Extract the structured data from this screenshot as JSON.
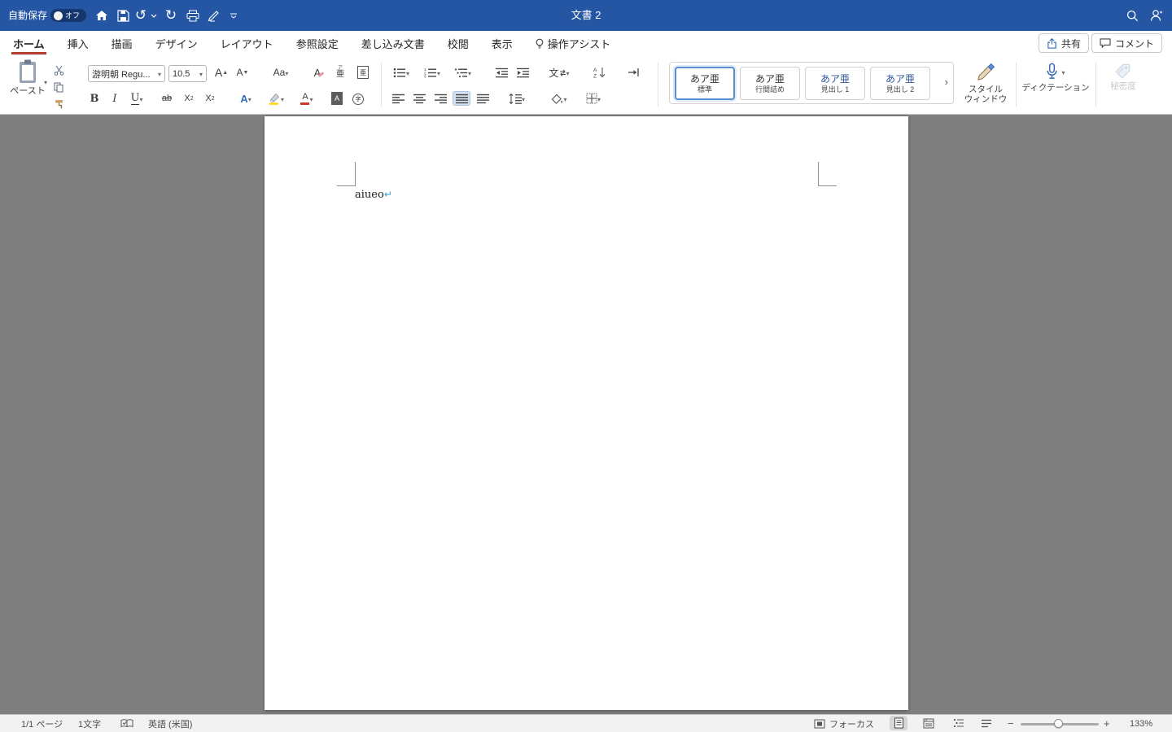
{
  "titlebar": {
    "autosave_label": "自動保存",
    "autosave_state": "オフ",
    "title": "文書 2"
  },
  "tabs": {
    "items": [
      {
        "label": "ホーム"
      },
      {
        "label": "挿入"
      },
      {
        "label": "描画"
      },
      {
        "label": "デザイン"
      },
      {
        "label": "レイアウト"
      },
      {
        "label": "参照設定"
      },
      {
        "label": "差し込み文書"
      },
      {
        "label": "校閲"
      },
      {
        "label": "表示"
      }
    ],
    "assist_label": "操作アシスト",
    "share_label": "共有",
    "comments_label": "コメント"
  },
  "ribbon": {
    "paste_label": "ペースト",
    "font_name": "游明朝 Regu...",
    "font_size": "10.5",
    "format": {
      "grow": "A",
      "shrink": "A",
      "case_label": "Aa",
      "clear": "A",
      "ruby_top": "ア",
      "ruby_base": "亜",
      "enclose_box": "亜",
      "bold": "B",
      "italic": "I",
      "underline": "U",
      "strikethrough": "ab",
      "sub_base": "X",
      "sub_script": "2",
      "sup_base": "X",
      "sup_script": "2",
      "effects": "A",
      "font_color": "A",
      "char_shade": "A",
      "enclose_circle": "字",
      "asian_layout": "文"
    },
    "styles": {
      "cards": [
        {
          "preview": "あア亜",
          "label": "標準"
        },
        {
          "preview": "あア亜",
          "label": "行間詰め"
        },
        {
          "preview": "あア亜",
          "label": "見出し 1"
        },
        {
          "preview": "あア亜",
          "label": "見出し 2"
        }
      ],
      "window_line1": "スタイル",
      "window_line2": "ウィンドウ"
    },
    "dictation_label": "ディクテーション",
    "sensitivity_label": "秘密度"
  },
  "document": {
    "text": "aiueo",
    "return_mark": "↵"
  },
  "statusbar": {
    "page_label": "1/1 ページ",
    "char_count": "1文字",
    "language": "英語 (米国)",
    "focus_label": "フォーカス",
    "zoom_level": "133%"
  },
  "colors": {
    "titlebar": "#2456a4",
    "accent_red": "#b23d31",
    "accent_blue": "#3a6db4"
  }
}
